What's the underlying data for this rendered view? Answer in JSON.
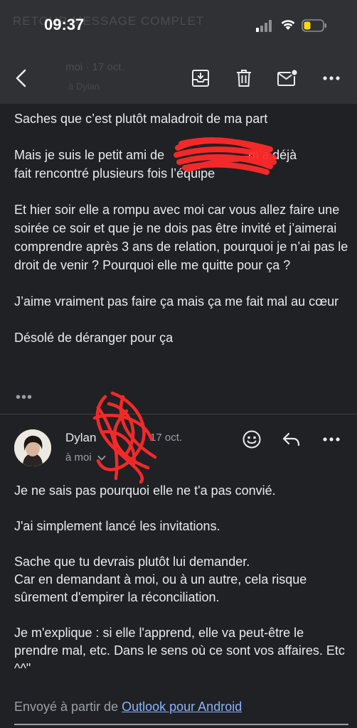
{
  "status_bar": {
    "time": "09:37",
    "ghost_title": "RETOUR MESSAGE COMPLET"
  },
  "toolbar": {
    "ghost_sender": "moi · 17 oct.",
    "ghost_sub": "à Dylan",
    "icons": [
      "back-arrow-icon",
      "archive-icon",
      "trash-icon",
      "mark-unread-icon",
      "more-icon"
    ]
  },
  "message1": {
    "paragraphs": [
      "Saches que c’est plutôt maladroit de ma part",
      "Mais je suis le petit ami de",
      "m’a déjà",
      "fait rencontré plusieurs fois l’équipe",
      "Et hier soir elle a rompu avec moi car vous allez faire une soirée ce soir et que je ne dois pas être invité et j’aimerai comprendre après 3 ans de relation, pourquoi je n’ai pas le droit de venir ? Pourquoi elle me quitte pour ça ?",
      "J’aime vraiment pas faire ça mais ça me fait mal au cœur",
      "Désolé de déranger pour ça"
    ],
    "more_label": "•••"
  },
  "message2": {
    "sender": "Dylan",
    "date": "17 oct.",
    "recipient": "à moi",
    "paragraphs": [
      "Je ne sais pas pourquoi elle ne t'a pas convié.",
      "J'ai simplement lancé les invitations.",
      "Sache que tu devrais plutôt lui demander.",
      "Car en demandant à moi, ou à un autre, cela risque sûrement d'empirer la réconciliation.",
      "Je m'explique : si elle l'apprend, elle va peut-être le prendre mal, etc. Dans le sens où ce sont vos affaires. Etc ^^\""
    ],
    "signature_prefix": "Envoyé à partir de",
    "signature_link": "Outlook pour Android"
  },
  "colors": {
    "background": "#202124",
    "toolbar": "#303134",
    "text": "#e8eaed",
    "muted": "#9aa0a6",
    "link": "#8ab4f8",
    "redaction": "#ff2a2a",
    "battery": "#f5d90a"
  }
}
